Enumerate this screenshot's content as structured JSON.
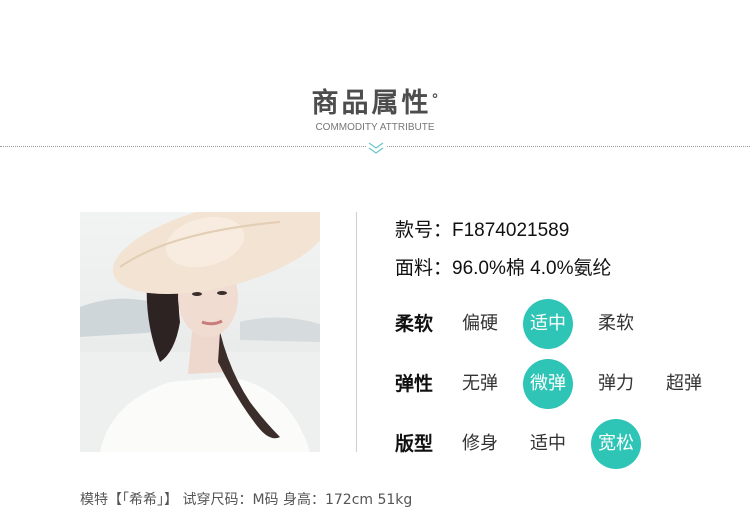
{
  "header": {
    "title": "商品属性",
    "title_mark": "°",
    "subtitle": "COMMODITY ATTRIBUTE"
  },
  "product": {
    "style_no": "款号：F1874021589",
    "fabric": "面料：96.0%棉 4.0%氨纶"
  },
  "attributes": [
    {
      "label": "柔软",
      "options": [
        "偏硬",
        "适中",
        "柔软"
      ],
      "selected": "适中"
    },
    {
      "label": "弹性",
      "options": [
        "无弹",
        "微弹",
        "弹力",
        "超弹"
      ],
      "selected": "微弹"
    },
    {
      "label": "版型",
      "options": [
        "修身",
        "适中",
        "宽松"
      ],
      "selected": "宽松"
    }
  ],
  "model_info": "模特【「希希」】 试穿尺码：M码 身高：172cm 51kg",
  "colors": {
    "accent": "#2ec4b6",
    "title": "#4d4d4d"
  },
  "icons": {
    "divider": "chevron-down-icon"
  }
}
